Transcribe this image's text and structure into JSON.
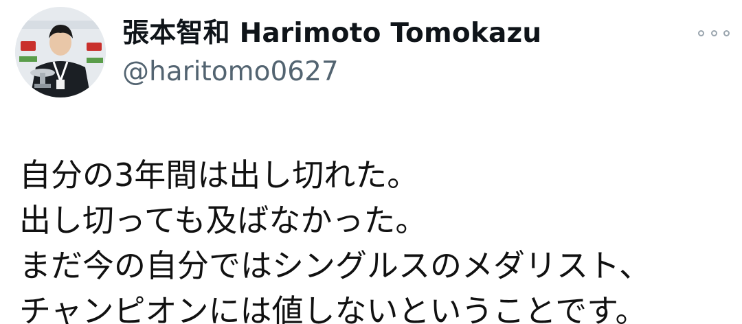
{
  "profile": {
    "display_name": "張本智和 Harimoto Tomokazu",
    "handle": "@haritomo0627",
    "avatar_icon": "profile-photo-icon",
    "more_icon": "more-options-icon"
  },
  "tweet": {
    "lines": [
      "自分の3年間は出し切れた。",
      "出し切っても及ばなかった。",
      "まだ今の自分ではシングルスのメダリスト、",
      "チャンピオンには値しないということです。"
    ]
  },
  "colors": {
    "text": "#111111",
    "handle": "#536471",
    "background": "#ffffff"
  }
}
